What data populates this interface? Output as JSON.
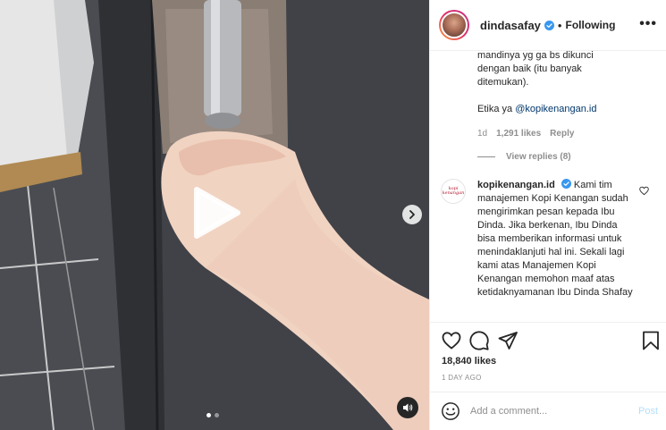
{
  "header": {
    "username": "dindasafay",
    "separator": "•",
    "follow_status": "Following",
    "more_label": "•••"
  },
  "reply": {
    "text_lines": [
      "mandinya yg ga bs dikunci",
      "dengan baik (itu banyak",
      "ditemukan)."
    ],
    "etika_prefix": "Etika ya ",
    "mention": "@kopikenangan.id",
    "time": "1d",
    "likes": "1,291 likes",
    "reply_label": "Reply",
    "view_replies": "View replies (8)"
  },
  "comment": {
    "avatar_text": "kopi kenangan",
    "username": "kopikenangan.id",
    "text": "Kami tim manajemen Kopi Kenangan sudah mengirimkan pesan kepada Ibu Dinda. Jika berkenan, Ibu Dinda bisa memberikan informasi untuk menindaklanjuti hal ini. Sekali lagi kami atas Manajemen Kopi Kenangan memohon maaf atas ketidaknyamanan Ibu Dinda Shafay"
  },
  "post": {
    "likes": "18,840 likes",
    "time_ago": "1 DAY AGO"
  },
  "composer": {
    "placeholder": "Add a comment...",
    "post_label": "Post"
  },
  "media": {
    "carousel_count": 2,
    "carousel_active": 0
  },
  "colors": {
    "verified": "#3897f0",
    "link": "#00376b",
    "secondary_text": "#8e8e8e",
    "post_disabled": "#b2dffc"
  },
  "icons": [
    "play-icon",
    "chevron-right-icon",
    "speaker-icon",
    "verified-icon",
    "heart-icon",
    "comment-icon",
    "share-icon",
    "bookmark-icon",
    "emoji-icon"
  ]
}
